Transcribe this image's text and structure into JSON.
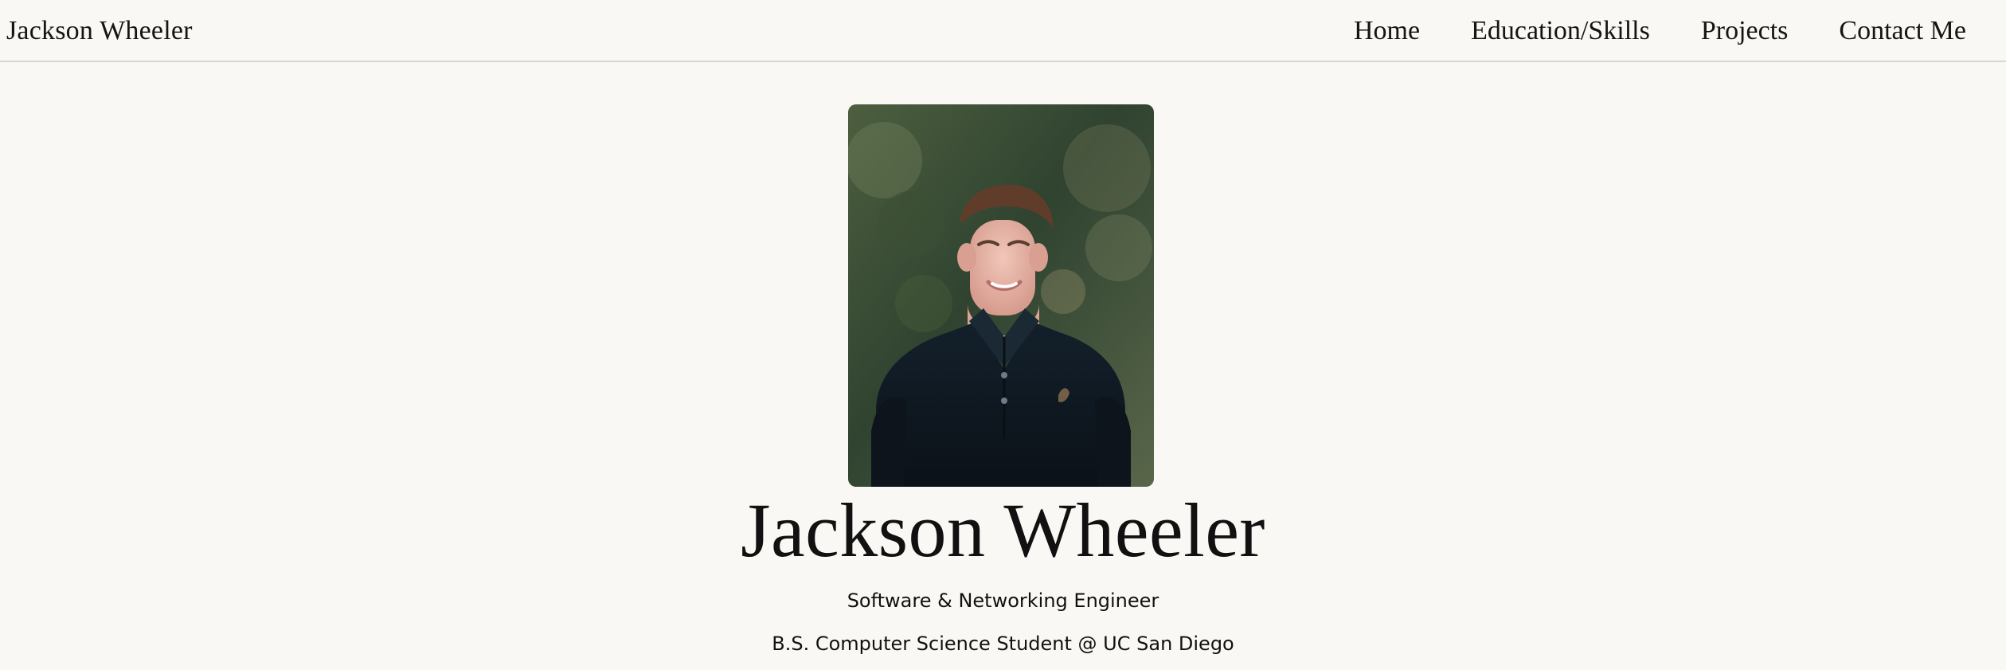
{
  "site": {
    "brand": "Jackson Wheeler"
  },
  "nav": {
    "items": [
      {
        "label": "Home"
      },
      {
        "label": "Education/Skills"
      },
      {
        "label": "Projects"
      },
      {
        "label": "Contact Me"
      }
    ]
  },
  "hero": {
    "name": "Jackson Wheeler",
    "role": "Software & Networking Engineer",
    "school": "B.S. Computer Science Student @ UC San Diego",
    "photo_icon": "profile-photo"
  },
  "colors": {
    "background": "#f9f8f4",
    "text": "#111111",
    "divider": "#d6d6d6"
  }
}
